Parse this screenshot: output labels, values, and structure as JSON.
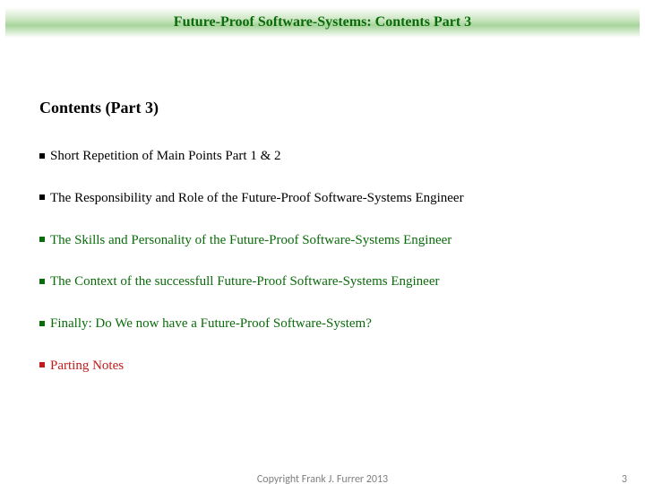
{
  "header": {
    "title": "Future-Proof Software-Systems: Contents Part 3"
  },
  "subtitle": "Contents (Part 3)",
  "items": [
    {
      "text": "Short Repetition of Main Points Part 1 & 2",
      "state": "visited"
    },
    {
      "text": "The Responsibility and Role of the Future-Proof Software-Systems Engineer",
      "state": "visited"
    },
    {
      "text": "The Skills and Personality of the Future-Proof Software-Systems Engineer",
      "state": "upcoming"
    },
    {
      "text": "The Context of the successfull Future-Proof Software-Systems Engineer",
      "state": "upcoming"
    },
    {
      "text": "Finally: Do We now have a Future-Proof Software-System?",
      "state": "upcoming"
    },
    {
      "text": "Parting Notes",
      "state": "final"
    }
  ],
  "footer": {
    "copyright": "Copyright Frank J. Furrer 2013",
    "page": "3"
  },
  "colors": {
    "header_green": "#0a6b0a",
    "upcoming_green": "#0a6b0a",
    "final_red": "#c11b1b"
  }
}
